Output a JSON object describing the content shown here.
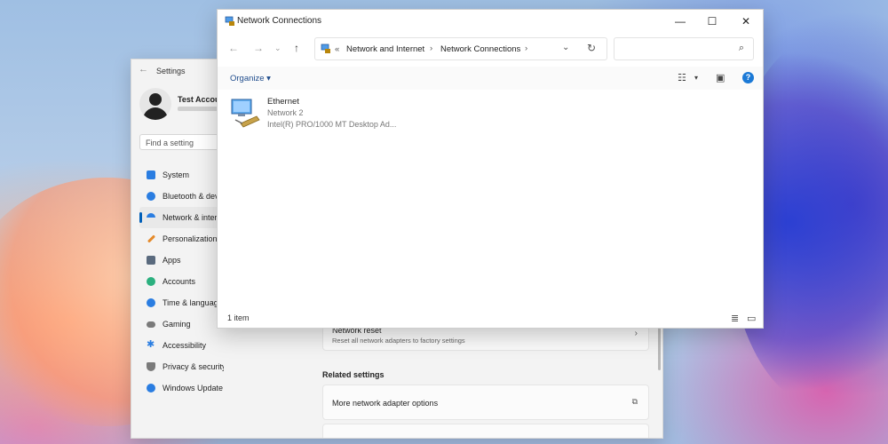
{
  "settings": {
    "title": "Settings",
    "account_name": "Test Account",
    "search_placeholder": "Find a setting",
    "nav": [
      {
        "label": "System",
        "icon": "monitor-icon",
        "color": "#2a7de1"
      },
      {
        "label": "Bluetooth & devices",
        "icon": "bluetooth-icon",
        "color": "#2a7de1"
      },
      {
        "label": "Network & internet",
        "icon": "wifi-icon",
        "color": "#2a7de1"
      },
      {
        "label": "Personalization",
        "icon": "brush-icon",
        "color": "#e58a2a"
      },
      {
        "label": "Apps",
        "icon": "apps-icon",
        "color": "#5a6a7e"
      },
      {
        "label": "Accounts",
        "icon": "person-icon",
        "color": "#2bb07f"
      },
      {
        "label": "Time & language",
        "icon": "globe-icon",
        "color": "#2a7de1"
      },
      {
        "label": "Gaming",
        "icon": "controller-icon",
        "color": "#7a7a7a"
      },
      {
        "label": "Accessibility",
        "icon": "accessibility-icon",
        "color": "#2a7de1"
      },
      {
        "label": "Privacy & security",
        "icon": "shield-icon",
        "color": "#7a7a7a"
      },
      {
        "label": "Windows Update",
        "icon": "update-icon",
        "color": "#2a7de1"
      }
    ],
    "network_reset": {
      "title": "Network reset",
      "description": "Reset all network adapters to factory settings"
    },
    "related_settings_title": "Related settings",
    "more_adapter_options": "More network adapter options"
  },
  "netconn": {
    "title": "Network Connections",
    "breadcrumb_lead": "«",
    "breadcrumb": [
      "Network and Internet",
      "Network Connections"
    ],
    "search_placeholder": "",
    "organize_label": "Organize ▾",
    "adapter": {
      "name": "Ethernet",
      "network": "Network 2",
      "device": "Intel(R) PRO/1000 MT Desktop Ad..."
    },
    "status_count": "1 item"
  },
  "colors": {
    "accent": "#005fb8",
    "help": "#1b79d6"
  }
}
